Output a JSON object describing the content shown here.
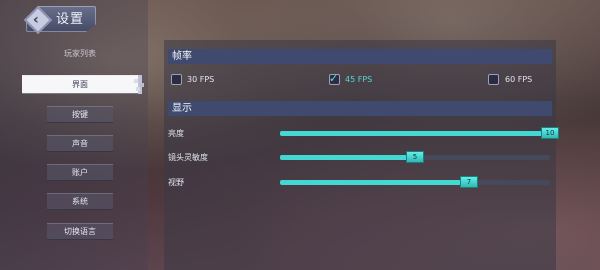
{
  "header": {
    "title": "设置"
  },
  "sidebar": {
    "items": [
      {
        "label": "玩家列表",
        "state": "faded"
      },
      {
        "label": "界面",
        "state": "active"
      },
      {
        "label": "按键",
        "state": "normal"
      },
      {
        "label": "声音",
        "state": "normal"
      },
      {
        "label": "账户",
        "state": "normal"
      },
      {
        "label": "系统",
        "state": "normal"
      },
      {
        "label": "切换语言",
        "state": "normal"
      }
    ]
  },
  "framerate": {
    "header": "帧率",
    "options": [
      {
        "label": "30 FPS",
        "checked": false
      },
      {
        "label": "45 FPS",
        "checked": true
      },
      {
        "label": "60 FPS",
        "checked": false
      }
    ]
  },
  "display": {
    "header": "显示",
    "sliders": [
      {
        "label": "亮度",
        "value": "10",
        "fraction": 1.0
      },
      {
        "label": "镜头灵敏度",
        "value": "5",
        "fraction": 0.5
      },
      {
        "label": "视野",
        "value": "7",
        "fraction": 0.7
      }
    ]
  },
  "colors": {
    "accent": "#43d8d2",
    "section_header": "#3f4a6e",
    "active_nav": "#f7f7fa"
  }
}
